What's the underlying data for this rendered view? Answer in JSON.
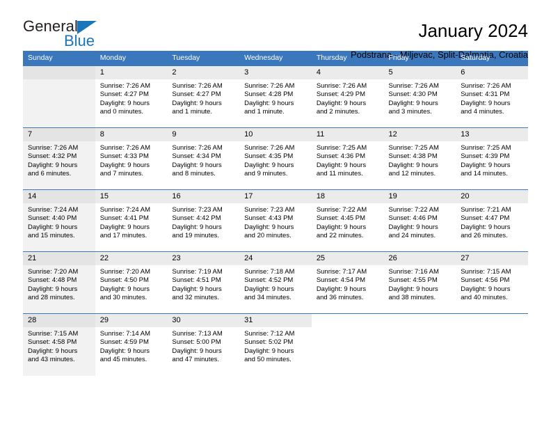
{
  "brand": {
    "name_top": "General",
    "name_bottom": "Blue",
    "accent_color": "#1b75bb",
    "logo_icon": "triangle-icon"
  },
  "header": {
    "title": "January 2024",
    "subtitle": "Podstrana - Miljevac, Split-Dalmatia, Croatia"
  },
  "theme": {
    "header_row_bg": "#3a77bc",
    "daynum_bg": "#ebebeb",
    "sunday_bg": "#f2f2f2"
  },
  "weekday_headers": [
    "Sunday",
    "Monday",
    "Tuesday",
    "Wednesday",
    "Thursday",
    "Friday",
    "Saturday"
  ],
  "weeks": [
    [
      {
        "day": ""
      },
      {
        "day": "1",
        "sunrise": "Sunrise: 7:26 AM",
        "sunset": "Sunset: 4:27 PM",
        "daylight1": "Daylight: 9 hours",
        "daylight2": "and 0 minutes."
      },
      {
        "day": "2",
        "sunrise": "Sunrise: 7:26 AM",
        "sunset": "Sunset: 4:27 PM",
        "daylight1": "Daylight: 9 hours",
        "daylight2": "and 1 minute."
      },
      {
        "day": "3",
        "sunrise": "Sunrise: 7:26 AM",
        "sunset": "Sunset: 4:28 PM",
        "daylight1": "Daylight: 9 hours",
        "daylight2": "and 1 minute."
      },
      {
        "day": "4",
        "sunrise": "Sunrise: 7:26 AM",
        "sunset": "Sunset: 4:29 PM",
        "daylight1": "Daylight: 9 hours",
        "daylight2": "and 2 minutes."
      },
      {
        "day": "5",
        "sunrise": "Sunrise: 7:26 AM",
        "sunset": "Sunset: 4:30 PM",
        "daylight1": "Daylight: 9 hours",
        "daylight2": "and 3 minutes."
      },
      {
        "day": "6",
        "sunrise": "Sunrise: 7:26 AM",
        "sunset": "Sunset: 4:31 PM",
        "daylight1": "Daylight: 9 hours",
        "daylight2": "and 4 minutes."
      }
    ],
    [
      {
        "day": "7",
        "sunrise": "Sunrise: 7:26 AM",
        "sunset": "Sunset: 4:32 PM",
        "daylight1": "Daylight: 9 hours",
        "daylight2": "and 6 minutes."
      },
      {
        "day": "8",
        "sunrise": "Sunrise: 7:26 AM",
        "sunset": "Sunset: 4:33 PM",
        "daylight1": "Daylight: 9 hours",
        "daylight2": "and 7 minutes."
      },
      {
        "day": "9",
        "sunrise": "Sunrise: 7:26 AM",
        "sunset": "Sunset: 4:34 PM",
        "daylight1": "Daylight: 9 hours",
        "daylight2": "and 8 minutes."
      },
      {
        "day": "10",
        "sunrise": "Sunrise: 7:26 AM",
        "sunset": "Sunset: 4:35 PM",
        "daylight1": "Daylight: 9 hours",
        "daylight2": "and 9 minutes."
      },
      {
        "day": "11",
        "sunrise": "Sunrise: 7:25 AM",
        "sunset": "Sunset: 4:36 PM",
        "daylight1": "Daylight: 9 hours",
        "daylight2": "and 11 minutes."
      },
      {
        "day": "12",
        "sunrise": "Sunrise: 7:25 AM",
        "sunset": "Sunset: 4:38 PM",
        "daylight1": "Daylight: 9 hours",
        "daylight2": "and 12 minutes."
      },
      {
        "day": "13",
        "sunrise": "Sunrise: 7:25 AM",
        "sunset": "Sunset: 4:39 PM",
        "daylight1": "Daylight: 9 hours",
        "daylight2": "and 14 minutes."
      }
    ],
    [
      {
        "day": "14",
        "sunrise": "Sunrise: 7:24 AM",
        "sunset": "Sunset: 4:40 PM",
        "daylight1": "Daylight: 9 hours",
        "daylight2": "and 15 minutes."
      },
      {
        "day": "15",
        "sunrise": "Sunrise: 7:24 AM",
        "sunset": "Sunset: 4:41 PM",
        "daylight1": "Daylight: 9 hours",
        "daylight2": "and 17 minutes."
      },
      {
        "day": "16",
        "sunrise": "Sunrise: 7:23 AM",
        "sunset": "Sunset: 4:42 PM",
        "daylight1": "Daylight: 9 hours",
        "daylight2": "and 19 minutes."
      },
      {
        "day": "17",
        "sunrise": "Sunrise: 7:23 AM",
        "sunset": "Sunset: 4:43 PM",
        "daylight1": "Daylight: 9 hours",
        "daylight2": "and 20 minutes."
      },
      {
        "day": "18",
        "sunrise": "Sunrise: 7:22 AM",
        "sunset": "Sunset: 4:45 PM",
        "daylight1": "Daylight: 9 hours",
        "daylight2": "and 22 minutes."
      },
      {
        "day": "19",
        "sunrise": "Sunrise: 7:22 AM",
        "sunset": "Sunset: 4:46 PM",
        "daylight1": "Daylight: 9 hours",
        "daylight2": "and 24 minutes."
      },
      {
        "day": "20",
        "sunrise": "Sunrise: 7:21 AM",
        "sunset": "Sunset: 4:47 PM",
        "daylight1": "Daylight: 9 hours",
        "daylight2": "and 26 minutes."
      }
    ],
    [
      {
        "day": "21",
        "sunrise": "Sunrise: 7:20 AM",
        "sunset": "Sunset: 4:48 PM",
        "daylight1": "Daylight: 9 hours",
        "daylight2": "and 28 minutes."
      },
      {
        "day": "22",
        "sunrise": "Sunrise: 7:20 AM",
        "sunset": "Sunset: 4:50 PM",
        "daylight1": "Daylight: 9 hours",
        "daylight2": "and 30 minutes."
      },
      {
        "day": "23",
        "sunrise": "Sunrise: 7:19 AM",
        "sunset": "Sunset: 4:51 PM",
        "daylight1": "Daylight: 9 hours",
        "daylight2": "and 32 minutes."
      },
      {
        "day": "24",
        "sunrise": "Sunrise: 7:18 AM",
        "sunset": "Sunset: 4:52 PM",
        "daylight1": "Daylight: 9 hours",
        "daylight2": "and 34 minutes."
      },
      {
        "day": "25",
        "sunrise": "Sunrise: 7:17 AM",
        "sunset": "Sunset: 4:54 PM",
        "daylight1": "Daylight: 9 hours",
        "daylight2": "and 36 minutes."
      },
      {
        "day": "26",
        "sunrise": "Sunrise: 7:16 AM",
        "sunset": "Sunset: 4:55 PM",
        "daylight1": "Daylight: 9 hours",
        "daylight2": "and 38 minutes."
      },
      {
        "day": "27",
        "sunrise": "Sunrise: 7:15 AM",
        "sunset": "Sunset: 4:56 PM",
        "daylight1": "Daylight: 9 hours",
        "daylight2": "and 40 minutes."
      }
    ],
    [
      {
        "day": "28",
        "sunrise": "Sunrise: 7:15 AM",
        "sunset": "Sunset: 4:58 PM",
        "daylight1": "Daylight: 9 hours",
        "daylight2": "and 43 minutes."
      },
      {
        "day": "29",
        "sunrise": "Sunrise: 7:14 AM",
        "sunset": "Sunset: 4:59 PM",
        "daylight1": "Daylight: 9 hours",
        "daylight2": "and 45 minutes."
      },
      {
        "day": "30",
        "sunrise": "Sunrise: 7:13 AM",
        "sunset": "Sunset: 5:00 PM",
        "daylight1": "Daylight: 9 hours",
        "daylight2": "and 47 minutes."
      },
      {
        "day": "31",
        "sunrise": "Sunrise: 7:12 AM",
        "sunset": "Sunset: 5:02 PM",
        "daylight1": "Daylight: 9 hours",
        "daylight2": "and 50 minutes."
      },
      {
        "day": ""
      },
      {
        "day": ""
      },
      {
        "day": ""
      }
    ]
  ]
}
